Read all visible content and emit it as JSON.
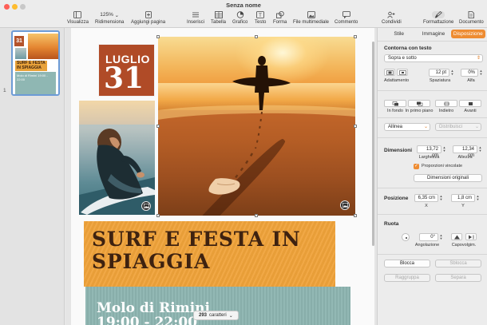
{
  "window": {
    "title": "Senza nome"
  },
  "toolbar": {
    "visualizza": "Visualizza",
    "zoom_value": "125%",
    "zoom_label": "Ridimensiona",
    "add_page": "Aggiungi pagina",
    "inserisci": "Inserisci",
    "tabella": "Tabella",
    "grafico": "Grafico",
    "testo": "Testo",
    "forma": "Forma",
    "file_multimediale": "File multimediale",
    "commento": "Commento",
    "condividi": "Condividi",
    "formattazione": "Formattazione",
    "documento": "Documento"
  },
  "sidebar": {
    "page_number": "1",
    "thumb": {
      "day": "31",
      "title": "SURF E FESTA IN SPIAGGIA",
      "teal": "Molo di Rimini 19:00 - 22:00"
    }
  },
  "page": {
    "month": "LUGLIO",
    "day": "31",
    "title_line1": "SURF E FESTA IN",
    "title_line2": "SPIAGGIA",
    "location": "Molo di Rimini",
    "time": "19:00 - 22:00",
    "char_count": "293",
    "char_label": "caratteri"
  },
  "inspector": {
    "tabs": [
      "Stile",
      "Immagine",
      "Disposizione"
    ],
    "active_tab": "Disposizione",
    "contorna": {
      "heading": "Contorna con testo",
      "value": "Sopra e sotto",
      "adattamento": "Adattamento",
      "spaziatura_value": "12 pt",
      "spaziatura_label": "Spaziatura",
      "alfa_value": "0%",
      "alfa_label": "Alfa"
    },
    "arrange": {
      "in_fondo": "In fondo",
      "in_primo_piano": "In primo piano",
      "indietro": "Indietro",
      "avanti": "Avanti"
    },
    "allinea": "Allinea",
    "distribuisci": "Distribuisci",
    "dimensioni": {
      "heading": "Dimensioni",
      "width_value": "13,72 cm",
      "width_label": "Larghezza",
      "height_value": "12,34 cm",
      "height_label": "Altezza",
      "constrain_label": "Proporzioni vincolate",
      "original_button": "Dimensioni originali"
    },
    "posizione": {
      "heading": "Posizione",
      "x_value": "6,35 cm",
      "x_label": "X",
      "y_value": "1,8 cm",
      "y_label": "Y"
    },
    "ruota": {
      "heading": "Ruota",
      "angle_value": "0°",
      "angle_label": "Angolazione",
      "flip_label": "Capovolgim."
    },
    "blocca": "Blocca",
    "sblocca": "Sblocca",
    "raggruppa": "Raggruppa",
    "separa": "Separa"
  },
  "colors": {
    "accent": "#ee8c32",
    "luglio_box": "#b04b27",
    "title_box": "#f0a33a",
    "teal_box": "#8cb4b0"
  }
}
